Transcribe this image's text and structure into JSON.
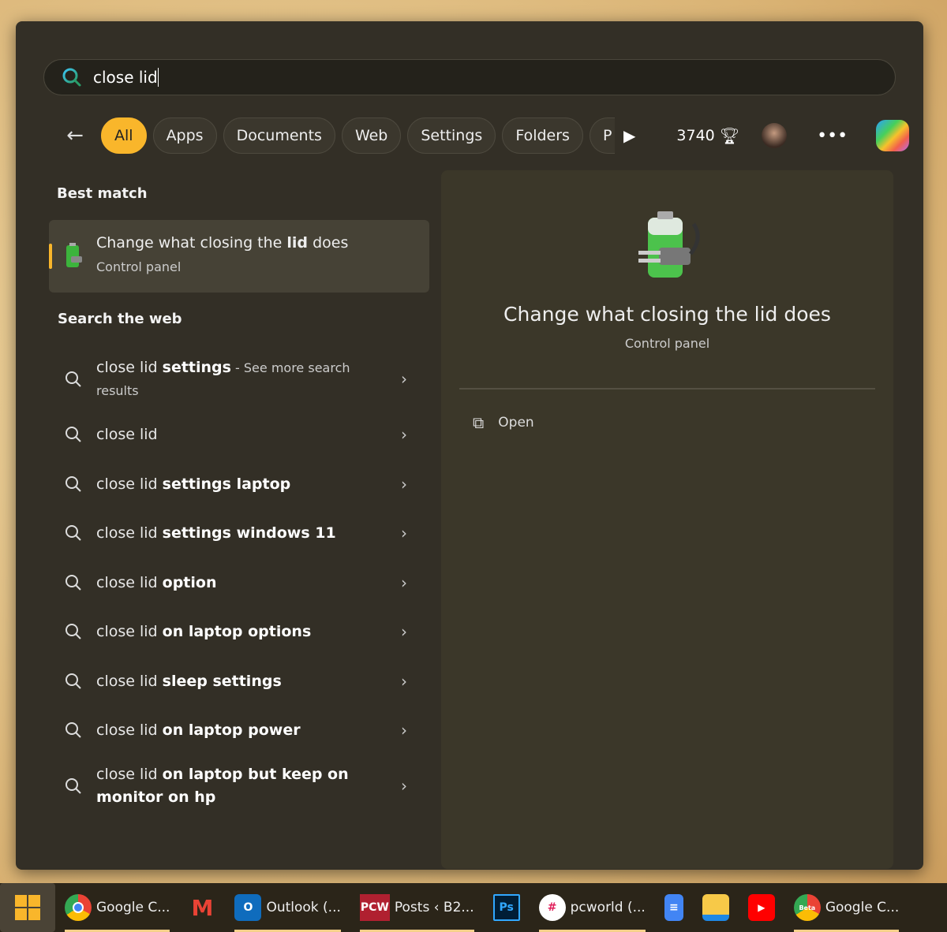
{
  "search": {
    "query": "close lid"
  },
  "filters": [
    "All",
    "Apps",
    "Documents",
    "Web",
    "Settings",
    "Folders",
    "P"
  ],
  "toolbar": {
    "points": "3740"
  },
  "best_match": {
    "heading": "Best match",
    "title_pre": "Change what closing the ",
    "title_bold": "lid",
    "title_post": " does",
    "subtitle": "Control panel"
  },
  "web": {
    "heading": "Search the web",
    "items": [
      {
        "pre": "close lid ",
        "bold": "settings",
        "more": " - See more search results"
      },
      {
        "pre": "close lid",
        "bold": ""
      },
      {
        "pre": "close lid ",
        "bold": "settings laptop"
      },
      {
        "pre": "close lid ",
        "bold": "settings windows 11"
      },
      {
        "pre": "close lid ",
        "bold": "option"
      },
      {
        "pre": "close lid ",
        "bold": "on laptop options"
      },
      {
        "pre": "close lid ",
        "bold": "sleep settings"
      },
      {
        "pre": "close lid ",
        "bold": "on laptop power"
      },
      {
        "pre": "close lid ",
        "bold": "on laptop but keep on monitor on hp"
      }
    ]
  },
  "preview": {
    "title": "Change what closing the lid does",
    "subtitle": "Control panel",
    "open_label": "Open"
  },
  "taskbar": {
    "items": [
      "Google C...",
      "",
      "Outlook (...",
      "Posts ‹ B2...",
      "",
      "pcworld (...",
      "",
      "",
      "",
      "Google C..."
    ],
    "pcw": "PCW",
    "ps": "Ps",
    "beta": "Beta"
  },
  "colors": {
    "accent": "#f9b62b",
    "panel": "#332f26"
  }
}
